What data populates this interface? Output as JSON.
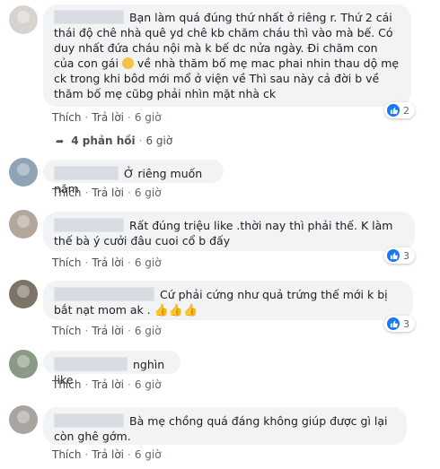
{
  "actions": {
    "like": "Thích",
    "reply": "Trả lời",
    "sep": "·"
  },
  "comments": [
    {
      "text_a": "Bạn làm quá đúng thứ nhất ở riêng r. Thứ 2 cái thái độ chê nhà quê yd chê kb chăm cháu thì vào mà bế. Có duy nhất đứa cháu nội mà k bế dc nửa ngày. Đi chăm con của con gái",
      "text_b": " về nhà thăm bố mẹ mac phai nhin thau dộ mẹ ck trong khi bôd mới mổ ở viện về Thì sau này cả đời b về thăm bố mẹ cũbg phải nhìn mặt nhà ck",
      "time": "6 giờ",
      "reactions": "2"
    },
    {
      "text": "Ở riêng muốn năm",
      "time": "6 giờ"
    },
    {
      "text": "Rất đúng triệu like .thời nay thì phải thế. K làm thế bà ý cưởi đâu cuoi cổ b đấy",
      "time": "6 giờ",
      "reactions": "3"
    },
    {
      "text": "Cứ phải cứng như quả trứng thế mới k bị bắt nạt mom ak .",
      "time": "6 giờ",
      "reactions": "3"
    },
    {
      "text": "nghìn like",
      "time": "6 giờ"
    },
    {
      "text": "Bà mẹ chồng quá đáng không giúp được gì lại còn ghê gớm.",
      "time": "6 giờ"
    }
  ],
  "replies": {
    "count_label": "4 phản hồi",
    "time": "6 giờ"
  },
  "colors": {
    "bubble": "#f2f3f5",
    "like_blue": "#1877f2",
    "meta": "#606770"
  }
}
